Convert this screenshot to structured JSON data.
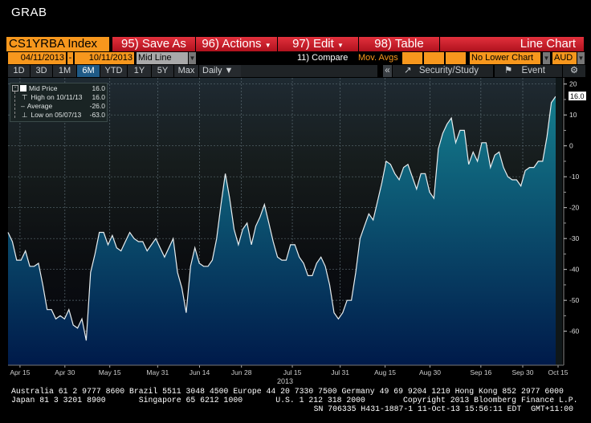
{
  "window_title": "GRAB",
  "toolbar": {
    "ticker": "CS1YRBA Index",
    "save_as": "95) Save As",
    "actions": "96) Actions",
    "edit": "97) Edit",
    "table": "98) Table",
    "chart_type": "Line Chart"
  },
  "controls": {
    "start_date": "04/11/2013",
    "date_sep": "-",
    "end_date": "10/11/2013",
    "line_type": "Mid Line",
    "compare": "11) Compare",
    "mov_avgs": "Mov. Avgs",
    "lower_chart": "No Lower Chart",
    "currency": "AUD"
  },
  "timeframes": [
    "1D",
    "3D",
    "1M",
    "6M",
    "YTD",
    "1Y",
    "5Y",
    "Max"
  ],
  "selected_timeframe": "6M",
  "frequency": "Daily",
  "right_tools": {
    "collapse": "«",
    "security_study": "Security/Study",
    "event": "Event"
  },
  "legend": {
    "mid_price_label": "Mid Price",
    "mid_price_value": "16.0",
    "high_label": "High on 10/11/13",
    "high_value": "16.0",
    "avg_label": "Average",
    "avg_value": "-26.0",
    "low_label": "Low on 05/07/13",
    "low_value": "-63.0"
  },
  "chart_data": {
    "type": "area",
    "title": "CS1YRBA Index",
    "series": [
      {
        "name": "Mid Price",
        "values": [
          -28,
          -31,
          -37,
          -37,
          -34,
          -39,
          -39,
          -38,
          -45,
          -53,
          -53,
          -56,
          -55,
          -56,
          -53,
          -58,
          -59,
          -56,
          -63,
          -41,
          -35,
          -28,
          -28,
          -32,
          -29,
          -33,
          -34,
          -31,
          -28,
          -30,
          -31,
          -31,
          -34,
          -32,
          -30,
          -33,
          -36,
          -33,
          -30,
          -41,
          -46,
          -54,
          -39,
          -33,
          -38,
          -39,
          -39,
          -37,
          -30,
          -19,
          -9,
          -17,
          -27,
          -32,
          -27,
          -25,
          -32,
          -26,
          -23,
          -19,
          -25,
          -31,
          -36,
          -37,
          -37,
          -32,
          -32,
          -36,
          -38,
          -42,
          -42,
          -38,
          -36,
          -39,
          -45,
          -54,
          -56,
          -54,
          -50,
          -50,
          -41,
          -30,
          -26,
          -22,
          -24,
          -18,
          -12,
          -5,
          -6,
          -9,
          -11,
          -7,
          -6,
          -10,
          -14,
          -9,
          -9,
          -15,
          -17,
          -1,
          4,
          7,
          9,
          1,
          5,
          5,
          -6,
          -2,
          -5,
          1,
          1,
          -7,
          -3,
          -2,
          -7,
          -10,
          -11,
          -11,
          -13,
          -8,
          -7,
          -7,
          -5,
          -5,
          3,
          14,
          16
        ]
      }
    ],
    "x_range_days": [
      0,
      183
    ],
    "x_ticks": [
      {
        "label": "Apr 15",
        "day": 4
      },
      {
        "label": "Apr 30",
        "day": 19
      },
      {
        "label": "May 15",
        "day": 34
      },
      {
        "label": "May 31",
        "day": 50
      },
      {
        "label": "Jun 14",
        "day": 64
      },
      {
        "label": "Jun 28",
        "day": 78
      },
      {
        "label": "Jul 15",
        "day": 95
      },
      {
        "label": "Jul 31",
        "day": 111
      },
      {
        "label": "Aug 15",
        "day": 126
      },
      {
        "label": "Aug 30",
        "day": 141
      },
      {
        "label": "Sep 16",
        "day": 158
      },
      {
        "label": "Sep 30",
        "day": 172
      },
      {
        "label": "Oct 15",
        "day": 184
      }
    ],
    "x_year_label": "2013",
    "y_ticks": [
      20,
      10,
      0,
      -10,
      -20,
      -30,
      -40,
      -50,
      -60
    ],
    "ylim": [
      -71,
      22
    ],
    "last_value_label": "16.0",
    "grid": true,
    "legend_position": "top-left",
    "colors": {
      "line": "#e8eef0",
      "fill_top": "#15808f",
      "fill_bottom": "#001a4a",
      "label_bg": "#ffffff"
    }
  },
  "footer": {
    "line1": "Australia 61 2 9777 8600 Brazil 5511 3048 4500 Europe 44 20 7330 7500 Germany 49 69 9204 1210 Hong Kong 852 2977 6000",
    "line2": "Japan 81 3 3201 8900       Singapore 65 6212 1000       U.S. 1 212 318 2000        Copyright 2013 Bloomberg Finance L.P.",
    "line3": "SN 706335 H431-1887-1 11-Oct-13 15:56:11 EDT  GMT+11:00"
  }
}
